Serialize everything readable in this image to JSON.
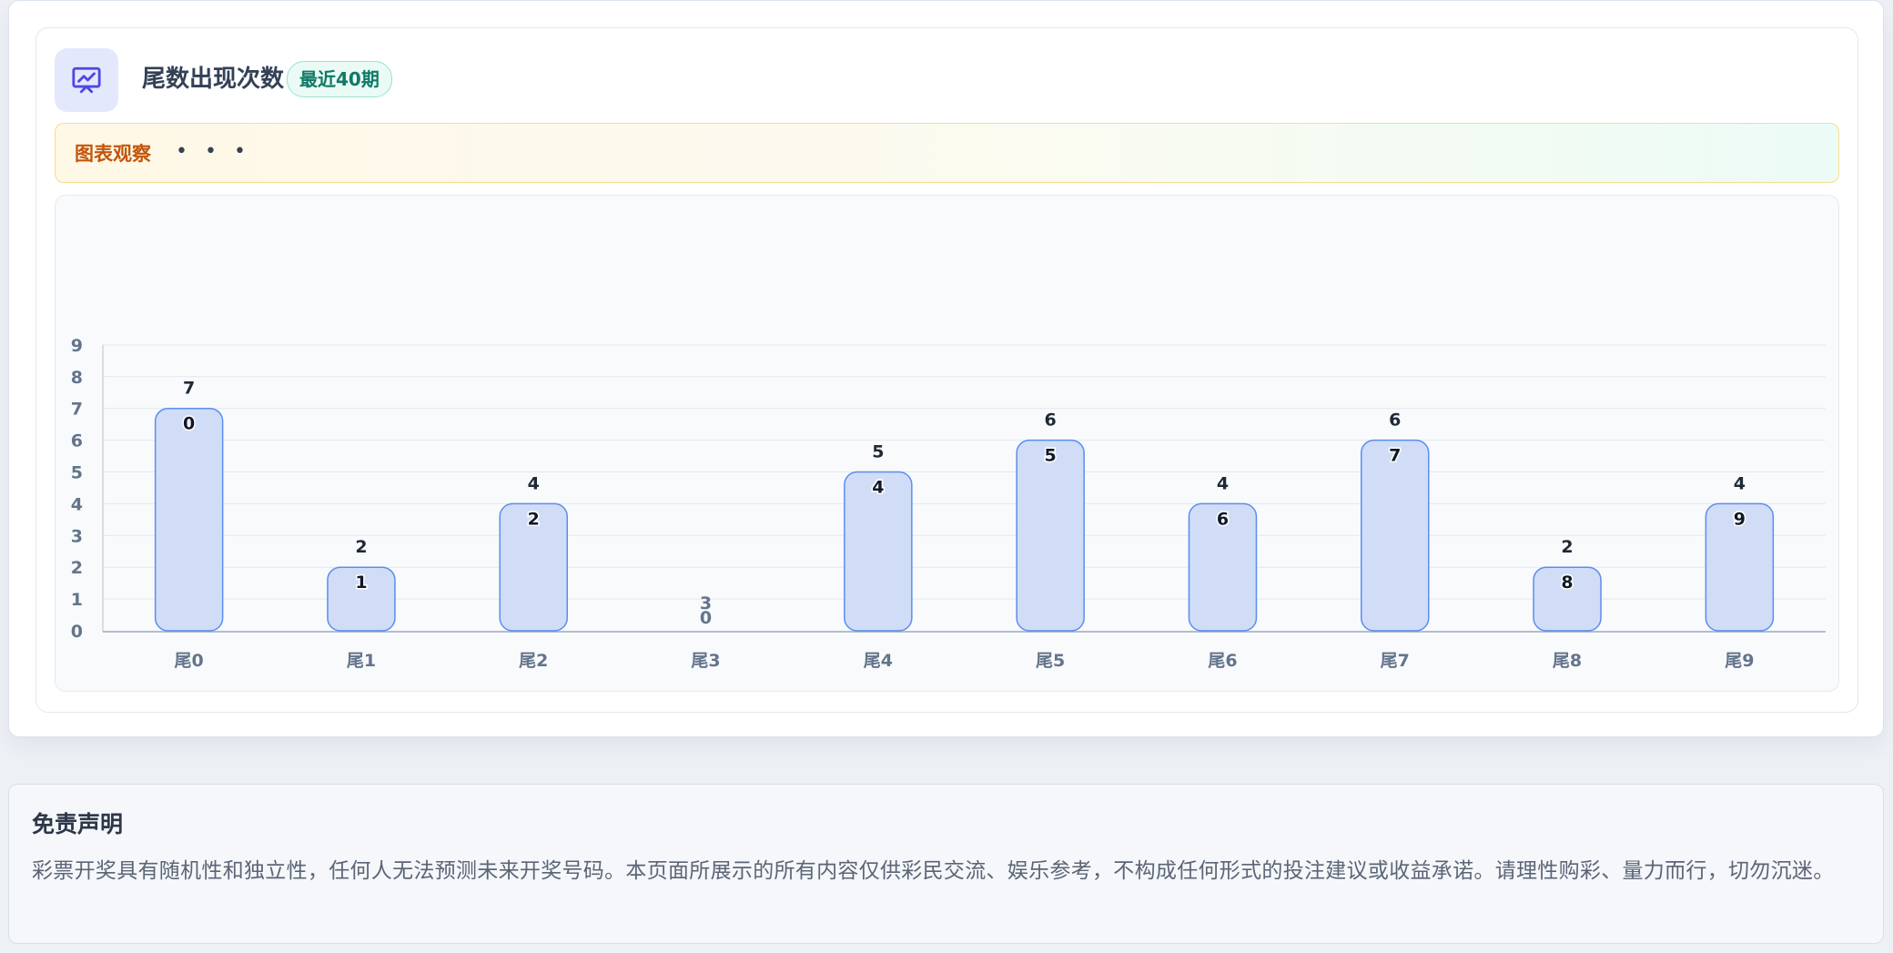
{
  "card": {
    "title": "尾数出现次数",
    "badge": "最近40期",
    "icon": "chart-presentation-icon",
    "observe_label": "图表观察",
    "observe_dots": "• • •"
  },
  "chart_data": {
    "type": "bar",
    "categories": [
      "尾0",
      "尾1",
      "尾2",
      "尾3",
      "尾4",
      "尾5",
      "尾6",
      "尾7",
      "尾8",
      "尾9"
    ],
    "values": [
      7,
      2,
      4,
      0,
      5,
      6,
      4,
      6,
      2,
      4
    ],
    "bar_labels": [
      "0",
      "1",
      "2",
      "3",
      "4",
      "5",
      "6",
      "7",
      "8",
      "9"
    ],
    "y_ticks": [
      0,
      1,
      2,
      3,
      4,
      5,
      6,
      7,
      8,
      9
    ],
    "ylim": [
      0,
      9
    ],
    "grid": true,
    "colors": {
      "bar_fill": "#d1ddf7",
      "bar_stroke": "#5b8def",
      "axis_text": "#64748b",
      "value_text": "#1f2937"
    }
  },
  "disclaimer": {
    "title": "免责声明",
    "text": "彩票开奖具有随机性和独立性，任何人无法预测未来开奖号码。本页面所展示的所有内容仅供彩民交流、娱乐参考，不构成任何形式的投注建议或收益承诺。请理性购彩、量力而行，切勿沉迷。"
  }
}
